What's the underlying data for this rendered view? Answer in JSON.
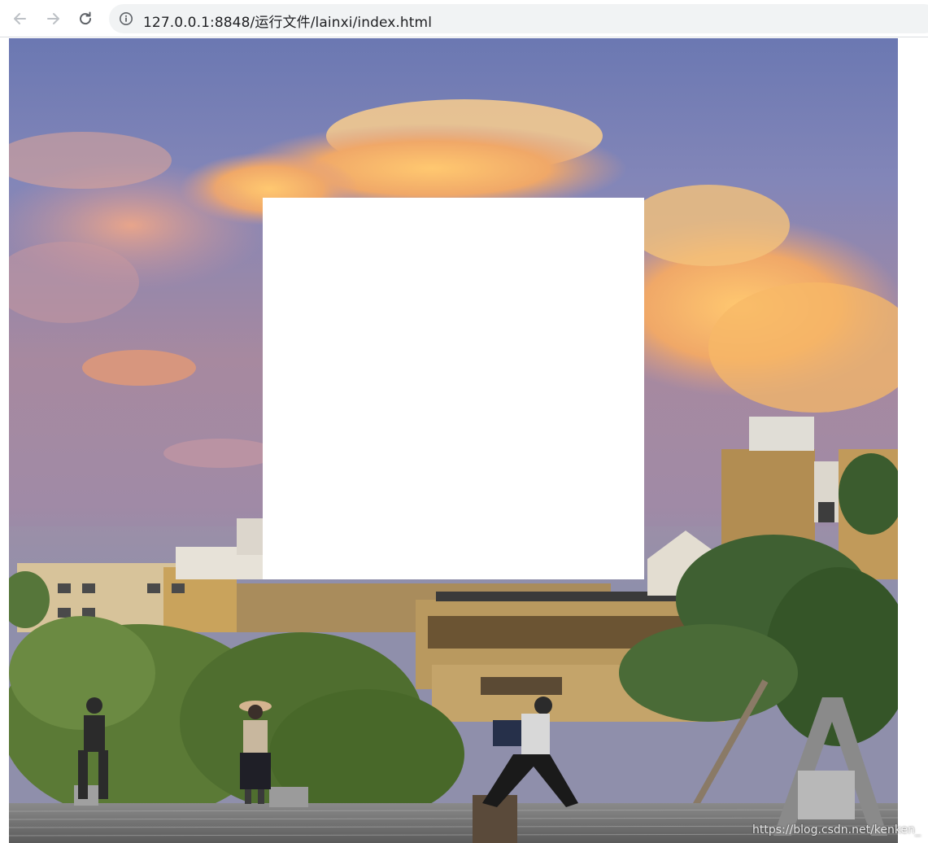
{
  "browser": {
    "url": "127.0.0.1:8848/运行文件/lainxi/index.html",
    "icons": {
      "back": "arrow-left-icon",
      "forward": "arrow-right-icon",
      "reload": "reload-icon",
      "site_info": "info-circle-icon"
    }
  },
  "page": {
    "background_image": "sunset-sky-city-street-photo",
    "center_box_color": "#ffffff",
    "watermark": "https://blog.csdn.net/kenken_"
  },
  "colors": {
    "sky_top": "#6f7db4",
    "cloud_orange": "#f6b96a",
    "foliage": "#5f7a3a",
    "building": "#b99a5c"
  }
}
